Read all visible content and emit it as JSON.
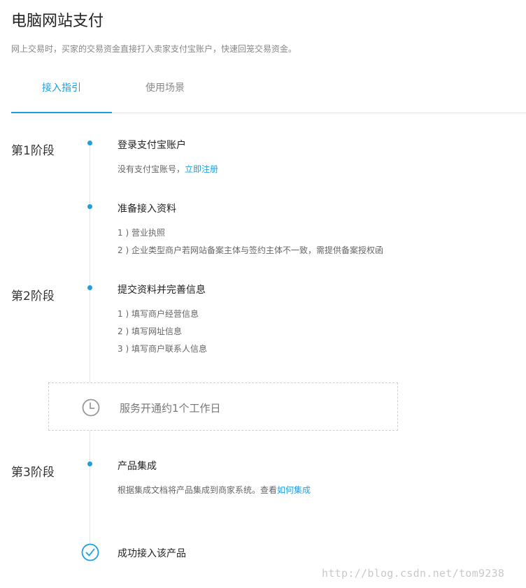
{
  "page": {
    "title": "电脑网站支付",
    "subtitle": "网上交易时，买家的交易资金直接打入卖家支付宝账户，快速回笼交易资金。"
  },
  "tabs": [
    {
      "label": "接入指引",
      "active": true
    },
    {
      "label": "使用场景",
      "active": false
    }
  ],
  "stages": [
    {
      "label": "第1阶段"
    },
    {
      "label": "第2阶段"
    },
    {
      "label": "第3阶段"
    }
  ],
  "steps": {
    "login": {
      "title": "登录支付宝账户",
      "text_prefix": "没有支付宝账号，",
      "link": "立即注册"
    },
    "prepare": {
      "title": "准备接入资料",
      "items": [
        "1 ) 营业执照",
        "2 ) 企业类型商户若网站备案主体与签约主体不一致，需提供备案授权函"
      ]
    },
    "submit": {
      "title": "提交资料并完善信息",
      "items": [
        "1 ) 填写商户经营信息",
        "2 ) 填写网址信息",
        "3 ) 填写商户联系人信息"
      ]
    },
    "integrate": {
      "title": "产品集成",
      "text_prefix": "根据集成文档将产品集成到商家系统。查看",
      "link": "如何集成"
    },
    "success": {
      "title": "成功接入该产品"
    }
  },
  "service": {
    "text": "服务开通约1个工作日",
    "icon": "clock-icon"
  },
  "watermark": "http://blog.csdn.net/tom9238",
  "colors": {
    "accent": "#1ca0e2",
    "text": "#333333",
    "muted": "#888888",
    "line": "#e5e5e5"
  }
}
